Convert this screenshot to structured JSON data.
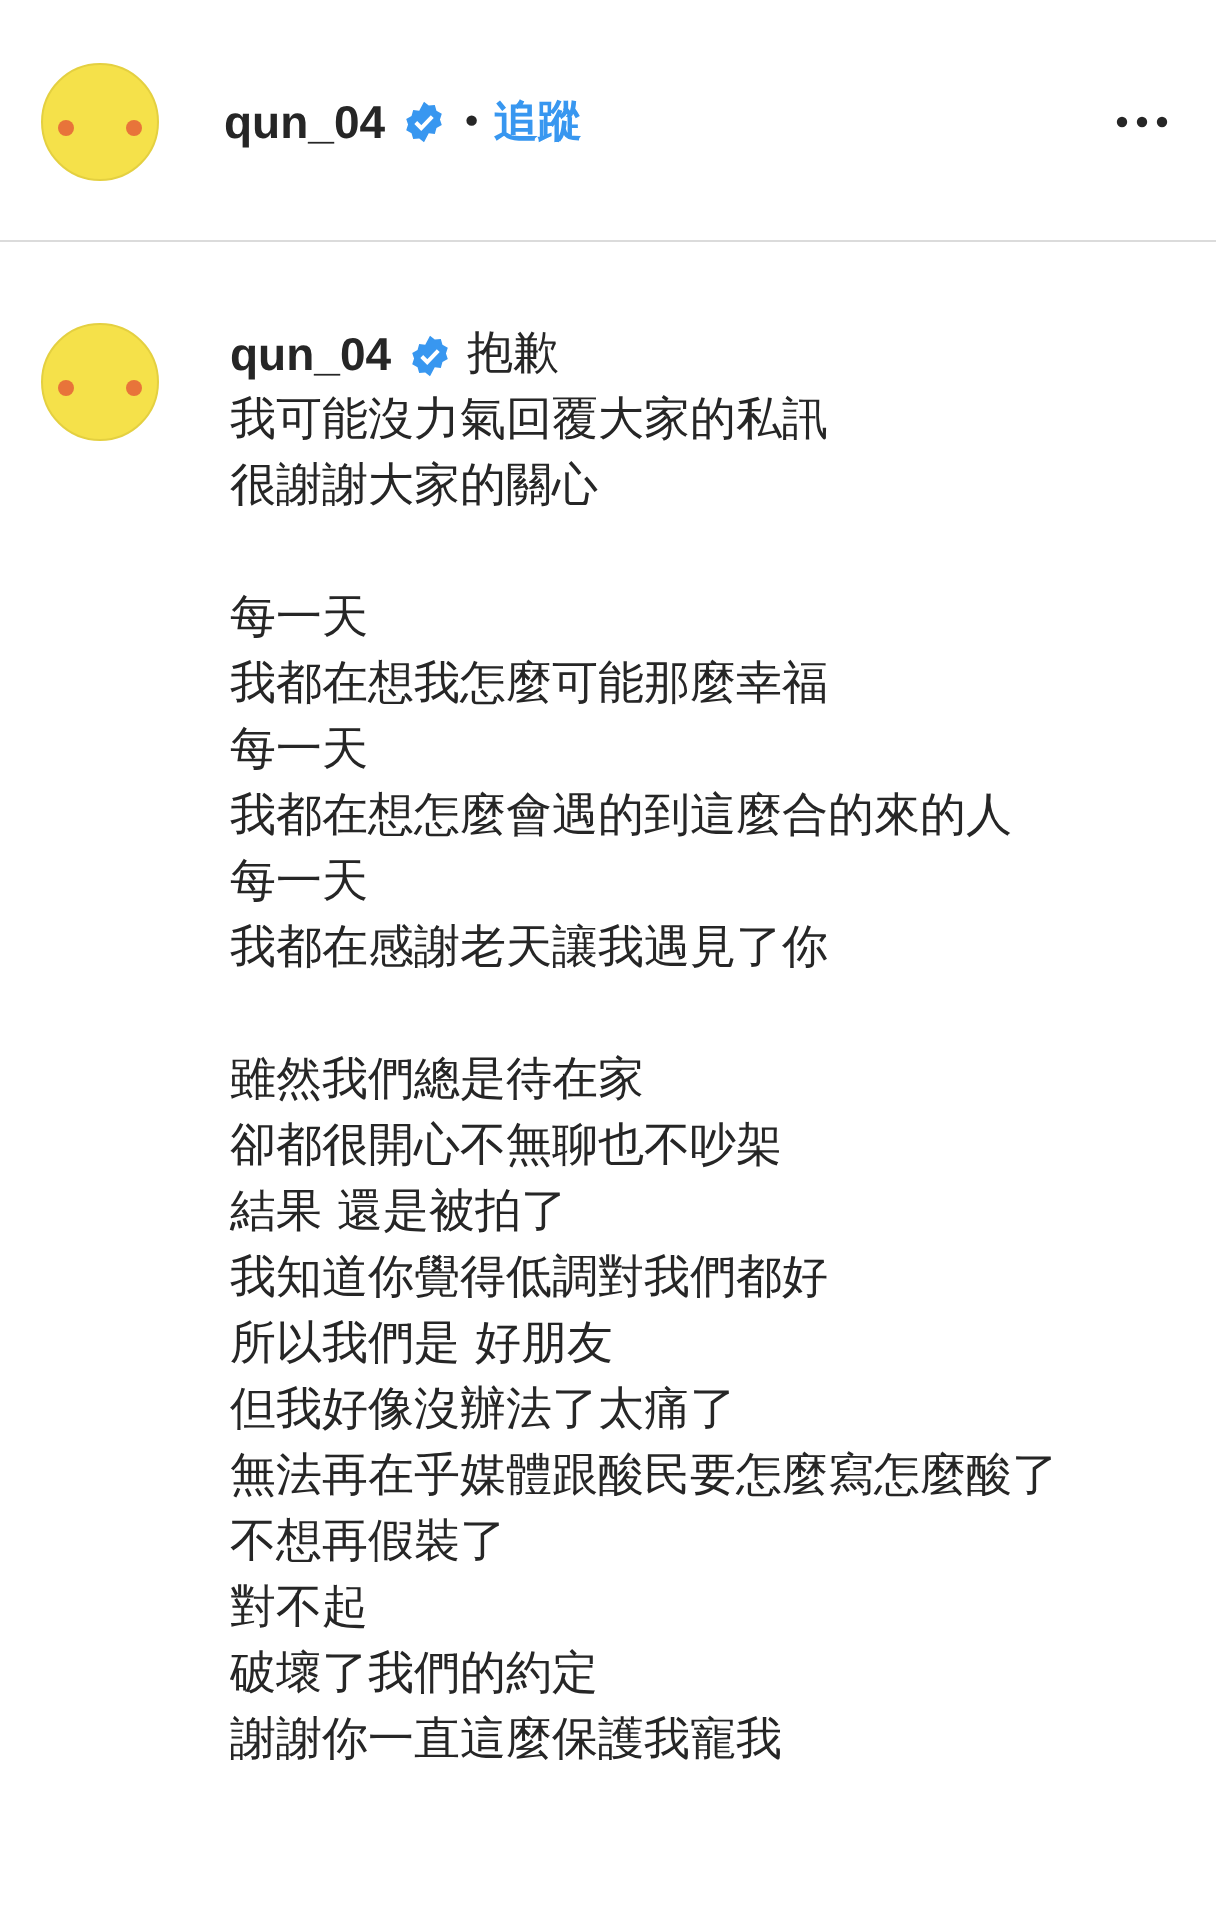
{
  "header": {
    "username": "qun_04",
    "verified": true,
    "separator": "•",
    "follow_label": "追蹤"
  },
  "caption": {
    "username": "qun_04",
    "verified": true,
    "first_line": "抱歉",
    "paragraphs": [
      [
        "我可能沒力氣回覆大家的私訊",
        "很謝謝大家的關心"
      ],
      [
        "每一天",
        "我都在想我怎麼可能那麼幸福",
        "每一天",
        "我都在想怎麼會遇的到這麼合的來的人",
        "每一天",
        "我都在感謝老天讓我遇見了你"
      ],
      [
        "雖然我們總是待在家",
        "卻都很開心不無聊也不吵架",
        "結果 還是被拍了",
        "我知道你覺得低調對我們都好",
        "所以我們是 好朋友",
        "但我好像沒辦法了太痛了",
        "無法再在乎媒體跟酸民要怎麼寫怎麼酸了",
        "不想再假裝了",
        "對不起",
        "破壞了我們的約定",
        "謝謝你一直這麼保護我寵我"
      ]
    ]
  }
}
